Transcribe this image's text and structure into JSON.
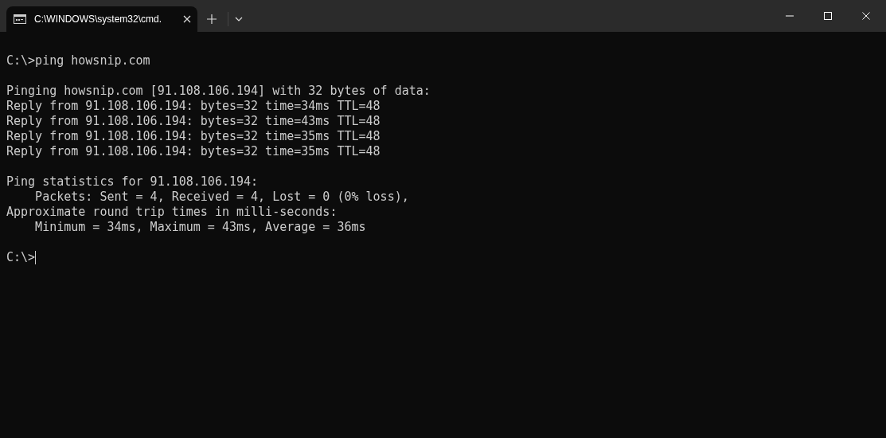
{
  "tab": {
    "title": "C:\\WINDOWS\\system32\\cmd.",
    "selected": true
  },
  "output_blocks": [
    [
      "C:\\>ping howsnip.com"
    ],
    [
      "Pinging howsnip.com [91.108.106.194] with 32 bytes of data:",
      "Reply from 91.108.106.194: bytes=32 time=34ms TTL=48",
      "Reply from 91.108.106.194: bytes=32 time=43ms TTL=48",
      "Reply from 91.108.106.194: bytes=32 time=35ms TTL=48",
      "Reply from 91.108.106.194: bytes=32 time=35ms TTL=48"
    ],
    [
      "Ping statistics for 91.108.106.194:",
      "    Packets: Sent = 4, Received = 4, Lost = 0 (0% loss),",
      "Approximate round trip times in milli-seconds:",
      "    Minimum = 34ms, Maximum = 43ms, Average = 36ms"
    ]
  ],
  "prompt": "C:\\>"
}
